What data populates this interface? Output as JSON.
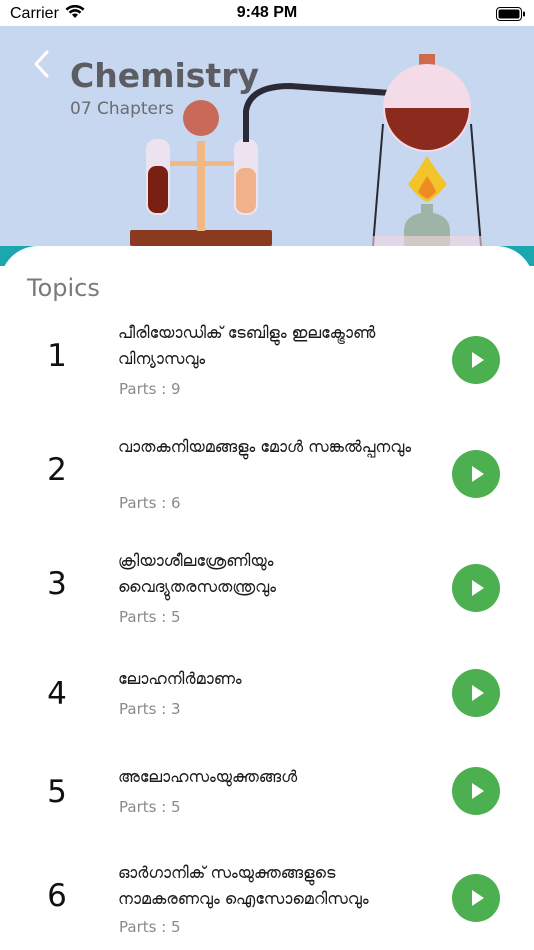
{
  "status_bar": {
    "carrier": "Carrier",
    "time": "9:48 PM"
  },
  "header": {
    "title": "Chemistry",
    "subtitle": "07 Chapters",
    "background_color": "#c7d7f0",
    "back_icon": "chevron-left-icon"
  },
  "topics_heading": "Topics",
  "topics": [
    {
      "number": "1",
      "title": "പീരിയോഡിക് ടേബിളും ഇലക്ട്രോൺ വിന്യാസവും",
      "parts": "Parts : 9"
    },
    {
      "number": "2",
      "title": "വാതകനിയമങ്ങളും മോൾ സങ്കൽപ്പനവും",
      "parts": "Parts : 6"
    },
    {
      "number": "3",
      "title": " ക്രിയാശീലശ്രേണിയും വൈദ്യുതരസതന്ത്രവും",
      "parts": "Parts : 5"
    },
    {
      "number": "4",
      "title": "ലോഹനിർമാണം",
      "parts": "Parts : 3"
    },
    {
      "number": "5",
      "title": "അലോഹസംയുക്തങ്ങൾ",
      "parts": "Parts : 5"
    },
    {
      "number": "6",
      "title": "ഓർഗാനിക് സംയുക്തങ്ങളുടെ നാമകരണവും ഐസോമെറിസവും",
      "parts": "Parts : 5"
    }
  ],
  "colors": {
    "accent": "#4caf50",
    "teal": "#1aa7b0"
  },
  "play_icon": "play-icon"
}
